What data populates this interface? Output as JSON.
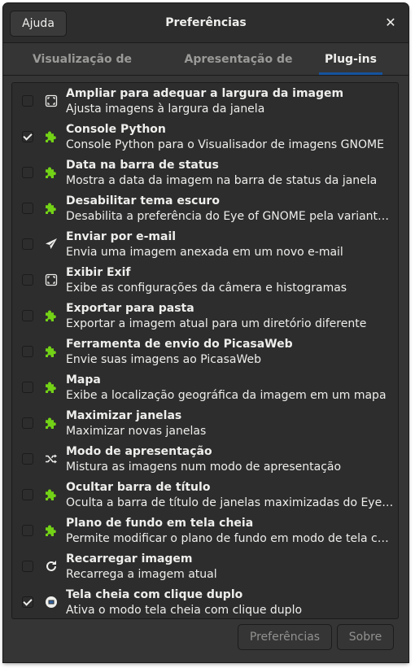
{
  "header": {
    "help_label": "Ajuda",
    "title": "Preferências",
    "close_glyph": "✕"
  },
  "tabs": [
    {
      "label": "Visualização de imagens",
      "active": false
    },
    {
      "label": "Apresentação de slides",
      "active": false
    },
    {
      "label": "Plug-ins",
      "active": true
    }
  ],
  "plugins": [
    {
      "name": "Ampliar para adequar a largura da imagem",
      "desc": "Ajusta imagens à largura da janela",
      "checked": false,
      "icon": "frame-icon"
    },
    {
      "name": "Console Python",
      "desc": "Console Python para o Visualisador de imagens GNOME",
      "checked": true,
      "icon": "puzzle-icon"
    },
    {
      "name": "Data na barra de status",
      "desc": "Mostra a data da imagem na barra de status da janela",
      "checked": false,
      "icon": "puzzle-icon"
    },
    {
      "name": "Desabilitar tema escuro",
      "desc": "Desabilita a preferência do Eye of GNOME pela variante escura do tema",
      "checked": false,
      "icon": "puzzle-icon"
    },
    {
      "name": "Enviar por e-mail",
      "desc": "Envia uma imagem anexada em um novo e-mail",
      "checked": false,
      "icon": "send-icon"
    },
    {
      "name": "Exibir Exif",
      "desc": "Exibe as configurações da câmera e histogramas",
      "checked": false,
      "icon": "frame-icon"
    },
    {
      "name": "Exportar para pasta",
      "desc": "Exportar a imagem atual para um diretório diferente",
      "checked": false,
      "icon": "puzzle-icon"
    },
    {
      "name": "Ferramenta de envio do PicasaWeb",
      "desc": "Envie suas imagens ao PicasaWeb",
      "checked": false,
      "icon": "puzzle-icon"
    },
    {
      "name": "Mapa",
      "desc": "Exibe a localização geográfica da imagem em um mapa",
      "checked": false,
      "icon": "puzzle-icon"
    },
    {
      "name": "Maximizar janelas",
      "desc": "Maximizar novas janelas",
      "checked": false,
      "icon": "puzzle-icon"
    },
    {
      "name": "Modo de apresentação",
      "desc": "Mistura as imagens num modo de apresentação",
      "checked": false,
      "icon": "shuffle-icon"
    },
    {
      "name": "Ocultar barra de título",
      "desc": "Oculta a barra de título de janelas maximizadas do Eye of GNOME",
      "checked": false,
      "icon": "puzzle-icon"
    },
    {
      "name": "Plano de fundo em tela cheia",
      "desc": "Permite modificar o plano de fundo em modo de tela cheia",
      "checked": false,
      "icon": "puzzle-icon"
    },
    {
      "name": "Recarregar imagem",
      "desc": "Recarrega a imagem atual",
      "checked": false,
      "icon": "reload-icon"
    },
    {
      "name": "Tela cheia com clique duplo",
      "desc": "Ativa o modo tela cheia com clique duplo",
      "checked": true,
      "icon": "fullscreen-icon"
    }
  ],
  "footer": {
    "preferences_label": "Preferências",
    "about_label": "Sobre"
  },
  "colors": {
    "accent": "#15539e",
    "background": "#353535",
    "list_background": "#2d2d2d",
    "text": "#eeeeec",
    "dim_text": "#919190",
    "puzzle_green": "#73d216"
  }
}
